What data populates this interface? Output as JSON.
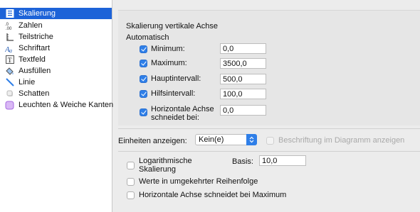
{
  "sidebar": {
    "items": [
      {
        "label": "Skalierung",
        "icon": "scale-icon",
        "active": true
      },
      {
        "label": "Zahlen",
        "icon": "numbers-icon",
        "active": false
      },
      {
        "label": "Teilstriche",
        "icon": "tick-marks-icon",
        "active": false
      },
      {
        "label": "Schriftart",
        "icon": "font-icon",
        "active": false
      },
      {
        "label": "Textfeld",
        "icon": "textbox-icon",
        "active": false
      },
      {
        "label": "Ausfüllen",
        "icon": "fill-bucket-icon",
        "active": false
      },
      {
        "label": "Linie",
        "icon": "line-icon",
        "active": false
      },
      {
        "label": "Schatten",
        "icon": "shadow-icon",
        "active": false
      },
      {
        "label": "Leuchten & Weiche Kanten",
        "icon": "glow-icon",
        "active": false
      }
    ]
  },
  "main": {
    "section_title": "Skalierung vertikale Achse",
    "automatic_label": "Automatisch",
    "rows": [
      {
        "label": "Minimum:",
        "value": "0,0",
        "checked": true
      },
      {
        "label": "Maximum:",
        "value": "3500,0",
        "checked": true
      },
      {
        "label": "Hauptintervall:",
        "value": "500,0",
        "checked": true
      },
      {
        "label": "Hilfsintervall:",
        "value": "100,0",
        "checked": true
      },
      {
        "label_line1": "Horizontale Achse",
        "label_line2": "schneidet bei:",
        "value": "0,0",
        "checked": true
      }
    ],
    "units_label": "Einheiten anzeigen:",
    "units_value": "Kein(e)",
    "show_label_in_chart": "Beschriftung im Diagramm anzeigen",
    "log_label_line1": "Logarithmische",
    "log_label_line2": "Skalierung",
    "base_label": "Basis:",
    "base_value": "10,0",
    "reverse_order": "Werte in umgekehrter Reihenfolge",
    "horizontal_at_max": "Horizontale Achse schneidet bei Maximum"
  },
  "colors": {
    "accent": "#2f7fe8",
    "selection": "#1d63d8"
  }
}
